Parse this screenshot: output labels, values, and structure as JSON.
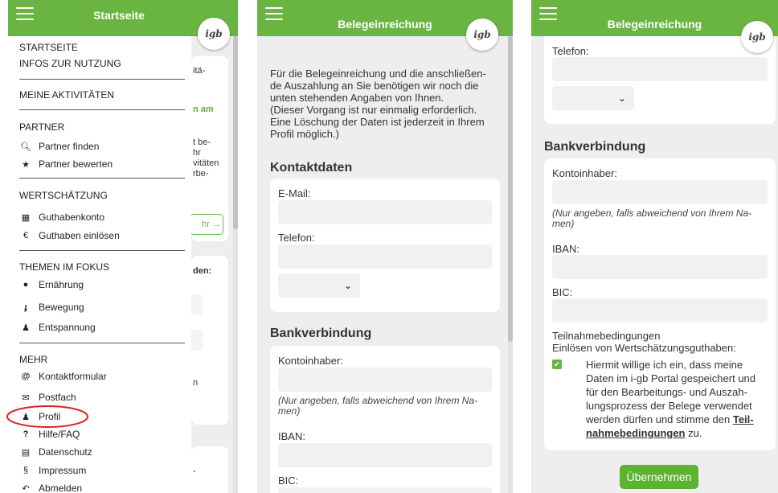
{
  "colors": {
    "brand_green": "#6ab542",
    "highlight_red": "#e02020"
  },
  "logo_text": "igb",
  "screen1": {
    "title": "Startseite",
    "menu": {
      "items_top": [
        "STARTSEITE",
        "INFOS ZUR NUTZUNG"
      ],
      "aktivitaeten": "MEINE AKTIVITÄTEN",
      "partner": {
        "heading": "PARTNER",
        "finden": "Partner finden",
        "bewerten": "Partner bewerten"
      },
      "wertschaetzung": {
        "heading": "WERTSCHÄTZUNG",
        "konto": "Guthabenkonto",
        "einloesen": "Guthaben einlösen"
      },
      "themen": {
        "heading": "THEMEN IM FOKUS",
        "ernaehrung": "Ernährung",
        "bewegung": "Bewegung",
        "entspannung": "Entspannung"
      },
      "mehr": {
        "heading": "MEHR",
        "kontakt": "Kontaktformular",
        "postfach": "Postfach",
        "profil": "Profil",
        "hilfe": "Hilfe/FAQ",
        "datenschutz": "Datenschutz",
        "impressum": "Impressum",
        "abmelden": "Abmelden"
      }
    },
    "background": {
      "t1": "itä-",
      "t2": "n am",
      "t3": [
        "t be-",
        "hr",
        "vitäten",
        "rbe-"
      ],
      "t4": "hr →",
      "t5": "den:",
      "t6": "n",
      "t7": "-"
    }
  },
  "screen2": {
    "title": "Belegeinreichung",
    "intro": [
      "Für die Belegeinreichung und die anschließen-",
      "de Auszahlung an Sie benötigen wir noch die",
      "unten stehenden Angaben von Ihnen.",
      "(Dieser Vorgang ist nur einmalig erforderlich.",
      "Eine Löschung der Daten ist jederzeit in Ihrem",
      "Profil möglich.)"
    ],
    "kontaktdaten": "Kontaktdaten",
    "email_label": "E-Mail:",
    "telefon_label": "Telefon:",
    "bankverbindung": "Bankverbindung",
    "kontoinhaber_label": "Kontoinhaber:",
    "note": [
      "(Nur angeben, falls abweichend von Ihrem Na-",
      "men)"
    ],
    "iban_label": "IBAN:",
    "bic_label": "BIC:"
  },
  "screen3": {
    "title": "Belegeinreichung",
    "telefon_label": "Telefon:",
    "bankverbindung": "Bankverbindung",
    "kontoinhaber_label": "Kontoinhaber:",
    "note": [
      "(Nur angeben, falls abweichend von Ihrem Na-",
      "men)"
    ],
    "iban_label": "IBAN:",
    "bic_label": "BIC:",
    "teilnahme_heading": "Teilnahmebedingungen",
    "teilnahme_sub": "Einlösen von Wertschätzungsguthaben:",
    "consent_lines": [
      "Hiermit willige ich ein, dass meine",
      "Daten im i-gb Portal gespeichert und",
      "für den Bearbeitungs- und Auszah-",
      "lungsprozess der Belege verwendet",
      "werden dürfen und stimme den"
    ],
    "consent_link1": "Teil-",
    "consent_link2": "nahmebedingungen",
    "consent_end": " zu.",
    "submit": "Übernehmen"
  }
}
